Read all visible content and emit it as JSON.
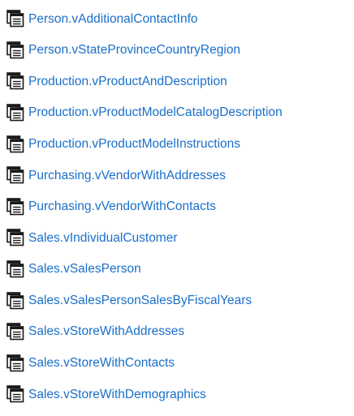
{
  "icon": "table-view-icon",
  "colors": {
    "link": "#1a6fc9",
    "icon_stroke": "#1a1a1a"
  },
  "views": [
    {
      "label": "Person.vAdditionalContactInfo"
    },
    {
      "label": "Person.vStateProvinceCountryRegion"
    },
    {
      "label": "Production.vProductAndDescription"
    },
    {
      "label": "Production.vProductModelCatalogDescription"
    },
    {
      "label": "Production.vProductModelInstructions"
    },
    {
      "label": "Purchasing.vVendorWithAddresses"
    },
    {
      "label": "Purchasing.vVendorWithContacts"
    },
    {
      "label": "Sales.vIndividualCustomer"
    },
    {
      "label": "Sales.vSalesPerson"
    },
    {
      "label": "Sales.vSalesPersonSalesByFiscalYears"
    },
    {
      "label": "Sales.vStoreWithAddresses"
    },
    {
      "label": "Sales.vStoreWithContacts"
    },
    {
      "label": "Sales.vStoreWithDemographics"
    }
  ]
}
